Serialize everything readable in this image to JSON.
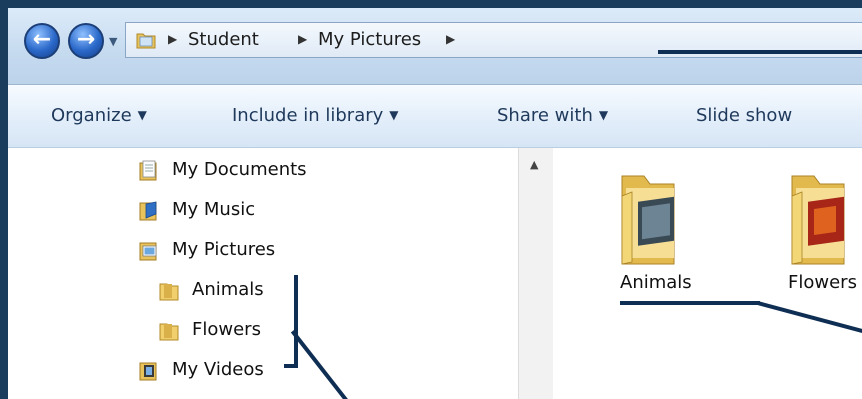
{
  "breadcrumb": [
    "Student",
    "My Pictures"
  ],
  "toolbar": {
    "organize": "Organize",
    "include_in_library": "Include in library",
    "share_with": "Share with",
    "slide_show": "Slide show"
  },
  "nav_tree": [
    {
      "label": "My Documents",
      "icon": "documents-library-icon"
    },
    {
      "label": "My Music",
      "icon": "music-library-icon"
    },
    {
      "label": "My Pictures",
      "icon": "pictures-library-icon"
    },
    {
      "label": "Animals",
      "icon": "folder-icon"
    },
    {
      "label": "Flowers",
      "icon": "folder-icon"
    },
    {
      "label": "My Videos",
      "icon": "videos-library-icon"
    }
  ],
  "content_items": [
    {
      "label": "Animals",
      "icon": "folder-animals-icon"
    },
    {
      "label": "Flowers",
      "icon": "folder-flowers-icon"
    }
  ],
  "colors": {
    "annotation": "#0f2e53",
    "accent": "#2a68c9"
  }
}
